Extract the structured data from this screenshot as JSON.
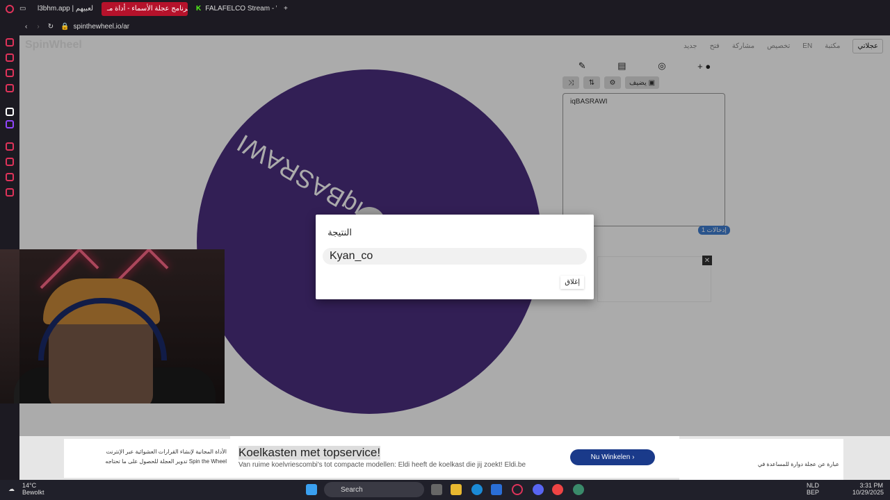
{
  "browser": {
    "tabs": [
      {
        "label": "l3bhm.app | لعبيهم"
      },
      {
        "label": "برنامج عجلة الأسماء - أداة مـ"
      },
      {
        "label": "FALAFELCO Stream - Wa"
      }
    ],
    "url": "spinthewheel.io/ar"
  },
  "app": {
    "logo": "SpinWheel",
    "my_button": "عجلاتي",
    "nav": [
      "جديد",
      "فتح",
      "مشاركة",
      "تخصيص",
      "EN",
      "مكتبة"
    ]
  },
  "wheel": {
    "entry_text": "iqBASRAWI",
    "color": "#4b2f7f"
  },
  "editor": {
    "add_image_label": "يضيف",
    "entries_text": "iqBASRAWI",
    "count_label": "إدخالات 1"
  },
  "dialog": {
    "title": "النتيجة",
    "result": "Kyan_co",
    "close_label": "إغلاق"
  },
  "ad": {
    "left_line1": "الأداة المجانية لإنشاء القرارات العشوائية عبر الإنترنت",
    "left_line2": "Spin the Wheel تدوير العجلة للحصول على ما تحتاجه",
    "title": "Koelkasten met topservice!",
    "subtitle": "Van ruime koelvriescombi's tot compacte modellen: Eldi heeft de koelkast die jij zoekt! Eldi.be",
    "button": "Nu Winkelen",
    "right_text": "عبارة عن عجلة دوارة للمساعدة في"
  },
  "taskbar": {
    "temp": "14°C",
    "weather": "Bewolkt",
    "search": "Search",
    "lang1": "NLD",
    "lang2": "BEP",
    "time": "3:31 PM",
    "date": "10/29/2025"
  }
}
